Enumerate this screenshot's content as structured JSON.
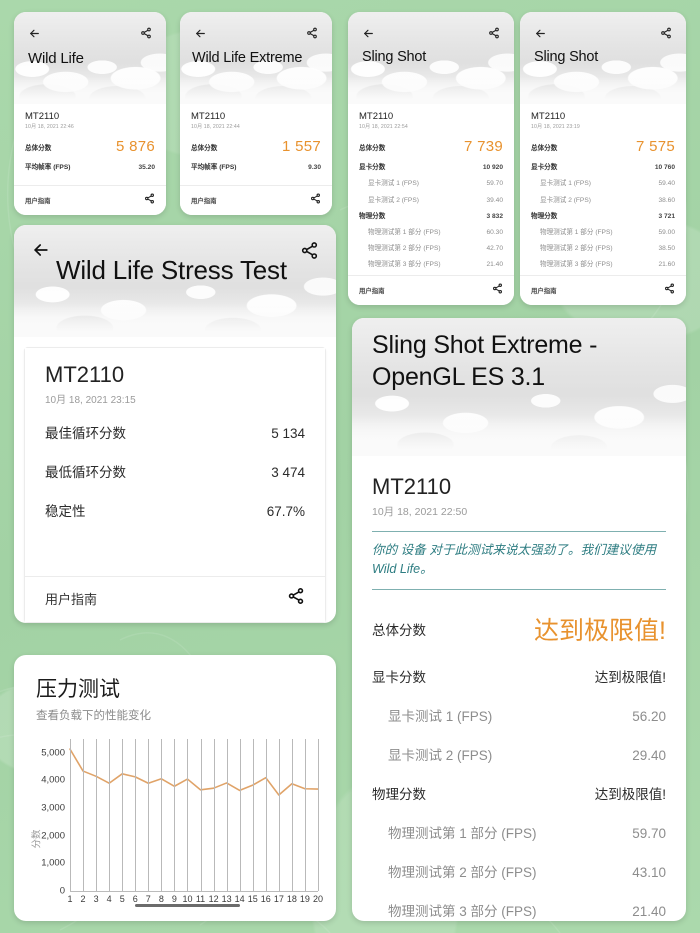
{
  "theme": {
    "background_green": "#a6d6a8",
    "accent_orange": "#e8922e",
    "note_teal": "#2e7d82",
    "card_white": "#ffffff"
  },
  "icons": {
    "back": "back-arrow-icon",
    "share": "share-icon"
  },
  "labels": {
    "device": "MT2110",
    "overall_score": "总体分数",
    "avg_fps": "平均帧率 (FPS)",
    "graphics_score": "显卡分数",
    "graphics_test_1": "显卡测试 1 (FPS)",
    "graphics_test_2": "显卡测试 2 (FPS)",
    "physics_score": "物理分数",
    "physics_test_1": "物理测试第 1 部分 (FPS)",
    "physics_test_2": "物理测试第 2 部分 (FPS)",
    "physics_test_3": "物理测试第 3 部分 (FPS)",
    "user_guide": "用户指南",
    "best_loop_score": "最佳循环分数",
    "worst_loop_score": "最低循环分数",
    "stability": "稳定性",
    "limit_reached": "达到极限值!"
  },
  "cards": {
    "wild_life": {
      "title": "Wild Life",
      "device": "MT2110",
      "date": "10月 18, 2021 22:46",
      "overall_label": "总体分数",
      "overall_value": "5 876",
      "rows": [
        {
          "label": "平均帧率 (FPS)",
          "value": "35.20"
        }
      ],
      "guide": "用户指南"
    },
    "wild_life_extreme": {
      "title": "Wild Life Extreme",
      "device": "MT2110",
      "date": "10月 18, 2021 22:44",
      "overall_label": "总体分数",
      "overall_value": "1 557",
      "rows": [
        {
          "label": "平均帧率 (FPS)",
          "value": "9.30"
        }
      ],
      "guide": "用户指南"
    },
    "sling_shot_1": {
      "title": "Sling Shot",
      "device": "MT2110",
      "date": "10月 18, 2021 22:54",
      "overall_label": "总体分数",
      "overall_value": "7 739",
      "rows": [
        {
          "label": "显卡分数",
          "value": "10 920",
          "sub": false
        },
        {
          "label": "显卡测试 1 (FPS)",
          "value": "59.70",
          "sub": true
        },
        {
          "label": "显卡测试 2 (FPS)",
          "value": "39.40",
          "sub": true
        },
        {
          "label": "物理分数",
          "value": "3 832",
          "sub": false
        },
        {
          "label": "物理测试第 1 部分 (FPS)",
          "value": "60.30",
          "sub": true
        },
        {
          "label": "物理测试第 2 部分 (FPS)",
          "value": "42.70",
          "sub": true
        },
        {
          "label": "物理测试第 3 部分 (FPS)",
          "value": "21.40",
          "sub": true
        }
      ],
      "guide": "用户指南"
    },
    "sling_shot_2": {
      "title": "Sling Shot",
      "device": "MT2110",
      "date": "10月 18, 2021 23:19",
      "overall_label": "总体分数",
      "overall_value": "7 575",
      "rows": [
        {
          "label": "显卡分数",
          "value": "10 760",
          "sub": false
        },
        {
          "label": "显卡测试 1 (FPS)",
          "value": "59.40",
          "sub": true
        },
        {
          "label": "显卡测试 2 (FPS)",
          "value": "38.60",
          "sub": true
        },
        {
          "label": "物理分数",
          "value": "3 721",
          "sub": false
        },
        {
          "label": "物理测试第 1 部分 (FPS)",
          "value": "59.00",
          "sub": true
        },
        {
          "label": "物理测试第 2 部分 (FPS)",
          "value": "38.50",
          "sub": true
        },
        {
          "label": "物理测试第 3 部分 (FPS)",
          "value": "21.60",
          "sub": true
        }
      ],
      "guide": "用户指南"
    },
    "stress_test": {
      "title": "Wild Life Stress Test",
      "device": "MT2110",
      "date": "10月 18, 2021 23:15",
      "rows": [
        {
          "label": "最佳循环分数",
          "value": "5 134"
        },
        {
          "label": "最低循环分数",
          "value": "3 474"
        },
        {
          "label": "稳定性",
          "value": "67.7%"
        }
      ],
      "guide": "用户指南"
    },
    "sling_shot_extreme": {
      "title": "Sling Shot Extreme - OpenGL ES 3.1",
      "device": "MT2110",
      "date": "10月 18, 2021 22:50",
      "note": "你的 设备 对于此测试来说太强劲了。我们建议使用 Wild Life。",
      "overall_label": "总体分数",
      "overall_value": "达到极限值!",
      "rows": [
        {
          "label": "显卡分数",
          "value": "达到极限值!",
          "sub": false
        },
        {
          "label": "显卡测试 1 (FPS)",
          "value": "56.20",
          "sub": true
        },
        {
          "label": "显卡测试 2 (FPS)",
          "value": "29.40",
          "sub": true
        },
        {
          "label": "物理分数",
          "value": "达到极限值!",
          "sub": false
        },
        {
          "label": "物理测试第 1 部分 (FPS)",
          "value": "59.70",
          "sub": true
        },
        {
          "label": "物理测试第 2 部分 (FPS)",
          "value": "43.10",
          "sub": true
        },
        {
          "label": "物理测试第 3 部分 (FPS)",
          "value": "21.40",
          "sub": true
        }
      ]
    }
  },
  "chart_card": {
    "title": "压力测试",
    "subtitle": "查看负载下的性能变化"
  },
  "chart_data": {
    "type": "line",
    "title": "压力测试",
    "subtitle": "查看负载下的性能变化",
    "xlabel": "",
    "ylabel": "分数",
    "categories": [
      "1",
      "2",
      "3",
      "4",
      "5",
      "6",
      "7",
      "8",
      "9",
      "10",
      "11",
      "12",
      "13",
      "14",
      "15",
      "16",
      "17",
      "18",
      "19",
      "20"
    ],
    "x": [
      1,
      2,
      3,
      4,
      5,
      6,
      7,
      8,
      9,
      10,
      11,
      12,
      13,
      14,
      15,
      16,
      17,
      18,
      19,
      20
    ],
    "values": [
      5134,
      4340,
      4150,
      3900,
      4240,
      4130,
      3900,
      4060,
      3790,
      4050,
      3660,
      3720,
      3910,
      3640,
      3830,
      4100,
      3474,
      3880,
      3700,
      3690
    ],
    "ylim": [
      0,
      5500
    ],
    "yticks": [
      0,
      1000,
      2000,
      3000,
      4000,
      5000
    ],
    "ytick_labels": [
      "0",
      "1,000",
      "2,000",
      "3,000",
      "4,000",
      "5,000"
    ],
    "grid": "vertical",
    "line_color": "#e0a368",
    "legend": "none",
    "scroll_hint_range": [
      6,
      14
    ]
  }
}
